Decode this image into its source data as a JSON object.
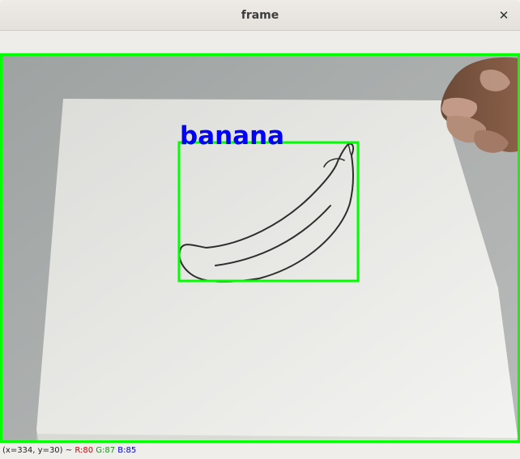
{
  "window": {
    "title": "frame",
    "close_glyph": "✕"
  },
  "frame": {
    "detection_label": "banana",
    "top_left_label": "banana",
    "box_color": "#00ff00",
    "label_color": "#0000ff"
  },
  "status": {
    "coords": "(x=334, y=30)",
    "separator": " ~ ",
    "r": "R:80",
    "g": "G:87",
    "b": "B:85"
  },
  "icons": {
    "close": "close-icon"
  }
}
